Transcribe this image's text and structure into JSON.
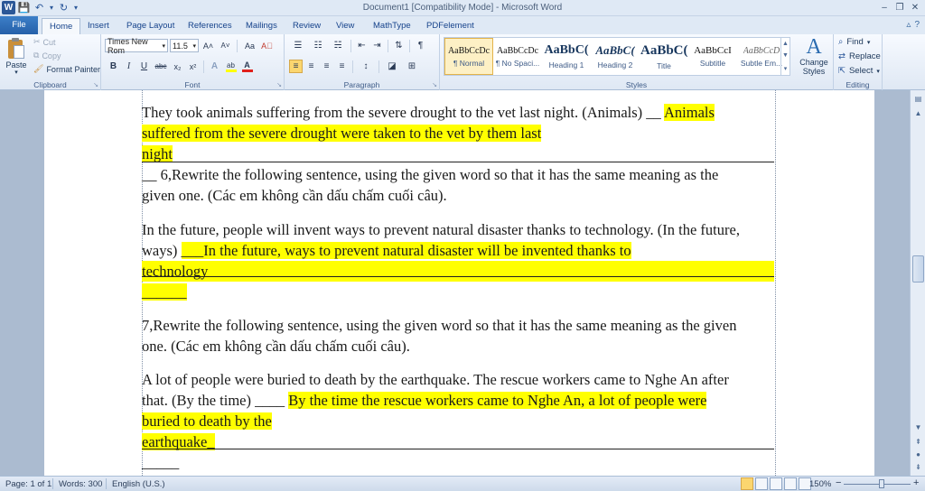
{
  "window": {
    "title": "Document1 [Compatibility Mode]  -  Microsoft Word",
    "app_icon": "W"
  },
  "qat": {
    "save_icon": "💾",
    "undo_icon": "↶",
    "undo_dropdown": "▾",
    "redo_icon": "↻",
    "customize_icon": "▾"
  },
  "window_controls": {
    "minimize": "–",
    "restore": "❐",
    "close": "✕"
  },
  "tabs": [
    "File",
    "Home",
    "Insert",
    "Page Layout",
    "References",
    "Mailings",
    "Review",
    "View",
    "MathType",
    "PDFelement"
  ],
  "tab_right": {
    "minimize_ribbon": "▵",
    "help": "?"
  },
  "clipboard": {
    "paste_label": "Paste",
    "paste_arrow": "▾",
    "cut_label": "Cut",
    "copy_label": "Copy",
    "format_painter_label": "Format Painter",
    "group_label": "Clipboard"
  },
  "font": {
    "family": "Times New Rom",
    "size": "11.5",
    "group_label": "Font",
    "grow": "A˄",
    "shrink": "A˅",
    "change_case": "Aa",
    "clear_formatting": "A⃠",
    "bold": "B",
    "italic": "I",
    "underline": "U",
    "strikethrough": "abc",
    "subscript": "x₂",
    "superscript": "x²",
    "text_effects": "A",
    "highlight": "ab",
    "font_color": "A",
    "highlight_color": "#ffff00",
    "font_color_swatch": "#e0201b"
  },
  "paragraph": {
    "group_label": "Paragraph",
    "bullets": "☰",
    "numbering": "☷",
    "multilevel": "☵",
    "decrease_indent": "⇤",
    "increase_indent": "⇥",
    "sort": "⇅",
    "show_marks": "¶",
    "align_left": "≡",
    "center": "≡",
    "align_right": "≡",
    "justify": "≡",
    "line_spacing": "↕",
    "shading": "◪",
    "borders": "⊞"
  },
  "styles": {
    "group_label": "Styles",
    "items": [
      {
        "sample": "AaBbCcDc",
        "name": "¶ Normal"
      },
      {
        "sample": "AaBbCcDc",
        "name": "¶ No Spaci..."
      },
      {
        "sample": "AaBbC(",
        "name": "Heading 1"
      },
      {
        "sample": "AaBbC(",
        "name": "Heading 2"
      },
      {
        "sample": "AaBbC(",
        "name": "Title"
      },
      {
        "sample": "AaBbCcI",
        "name": "Subtitle"
      },
      {
        "sample": "AaBbCcD",
        "name": "Subtle Em..."
      }
    ],
    "change_styles_label": "Change Styles",
    "change_styles_icon": "A"
  },
  "editing": {
    "group_label": "Editing",
    "find": "Find",
    "replace": "Replace",
    "select": "Select"
  },
  "document": {
    "lines": [
      {
        "parts": [
          {
            "t": "They took animals suffering from the severe drought to the vet last night. (Animals) __ "
          },
          {
            "t": "Animals",
            "hl": true
          }
        ]
      },
      {
        "parts": [
          {
            "t": "suffered from the severe drought were taken to the vet by them last",
            "hl": true
          }
        ]
      },
      {
        "parts": [
          {
            "t": "night ",
            "hl": true
          }
        ]
      },
      {
        "parts": [
          {
            "t": "__ 6,Rewrite the following sentence, using the given word so that it has the same meaning as the"
          }
        ]
      },
      {
        "parts": [
          {
            "t": "given one. (Các em không cần dấu chấm cuối câu)."
          }
        ]
      },
      {
        "parts": [
          {
            "t": "In the future, people will invent ways to prevent natural disaster thanks to technology. (In the future,"
          }
        ]
      },
      {
        "parts": [
          {
            "t": "ways) "
          },
          {
            "t": "___In the future, ways to prevent natural disaster will be invented thanks to",
            "hl": true
          }
        ]
      },
      {
        "parts": [
          {
            "t": "technology",
            "hl": true
          }
        ]
      },
      {
        "parts": [
          {
            "t": "______",
            "hl": true
          }
        ]
      },
      {
        "parts": [
          {
            "t": "7,Rewrite the following sentence, using the given word so that it has the same meaning as the given"
          }
        ]
      },
      {
        "parts": [
          {
            "t": "one. (Các em không cần dấu chấm cuối câu)."
          }
        ]
      },
      {
        "parts": [
          {
            "t": "A lot of people were buried to death by the earthquake. The rescue workers came to Nghe An after"
          }
        ]
      },
      {
        "parts": [
          {
            "t": "that. (By the time) ____ "
          },
          {
            "t": "By the time the rescue workers came to Nghe An, a lot of people were",
            "hl": true
          }
        ]
      },
      {
        "parts": [
          {
            "t": "buried to death by the",
            "hl": true
          }
        ]
      },
      {
        "parts": [
          {
            "t": "earthquake_",
            "hl": true
          }
        ]
      },
      {
        "parts": [
          {
            "t": "_____"
          }
        ]
      }
    ]
  },
  "statusbar": {
    "page": "Page: 1 of 1",
    "words": "Words: 300",
    "language": "English (U.S.)",
    "zoom": "150%",
    "zoom_out": "−",
    "zoom_in": "+"
  },
  "scrollbar": {
    "up": "▲",
    "down": "▼",
    "prev_page": "⇞",
    "select_browse": "●",
    "next_page": "⇟",
    "ruler_toggle": "▤",
    "thumb_position_fraction": 0.43
  }
}
